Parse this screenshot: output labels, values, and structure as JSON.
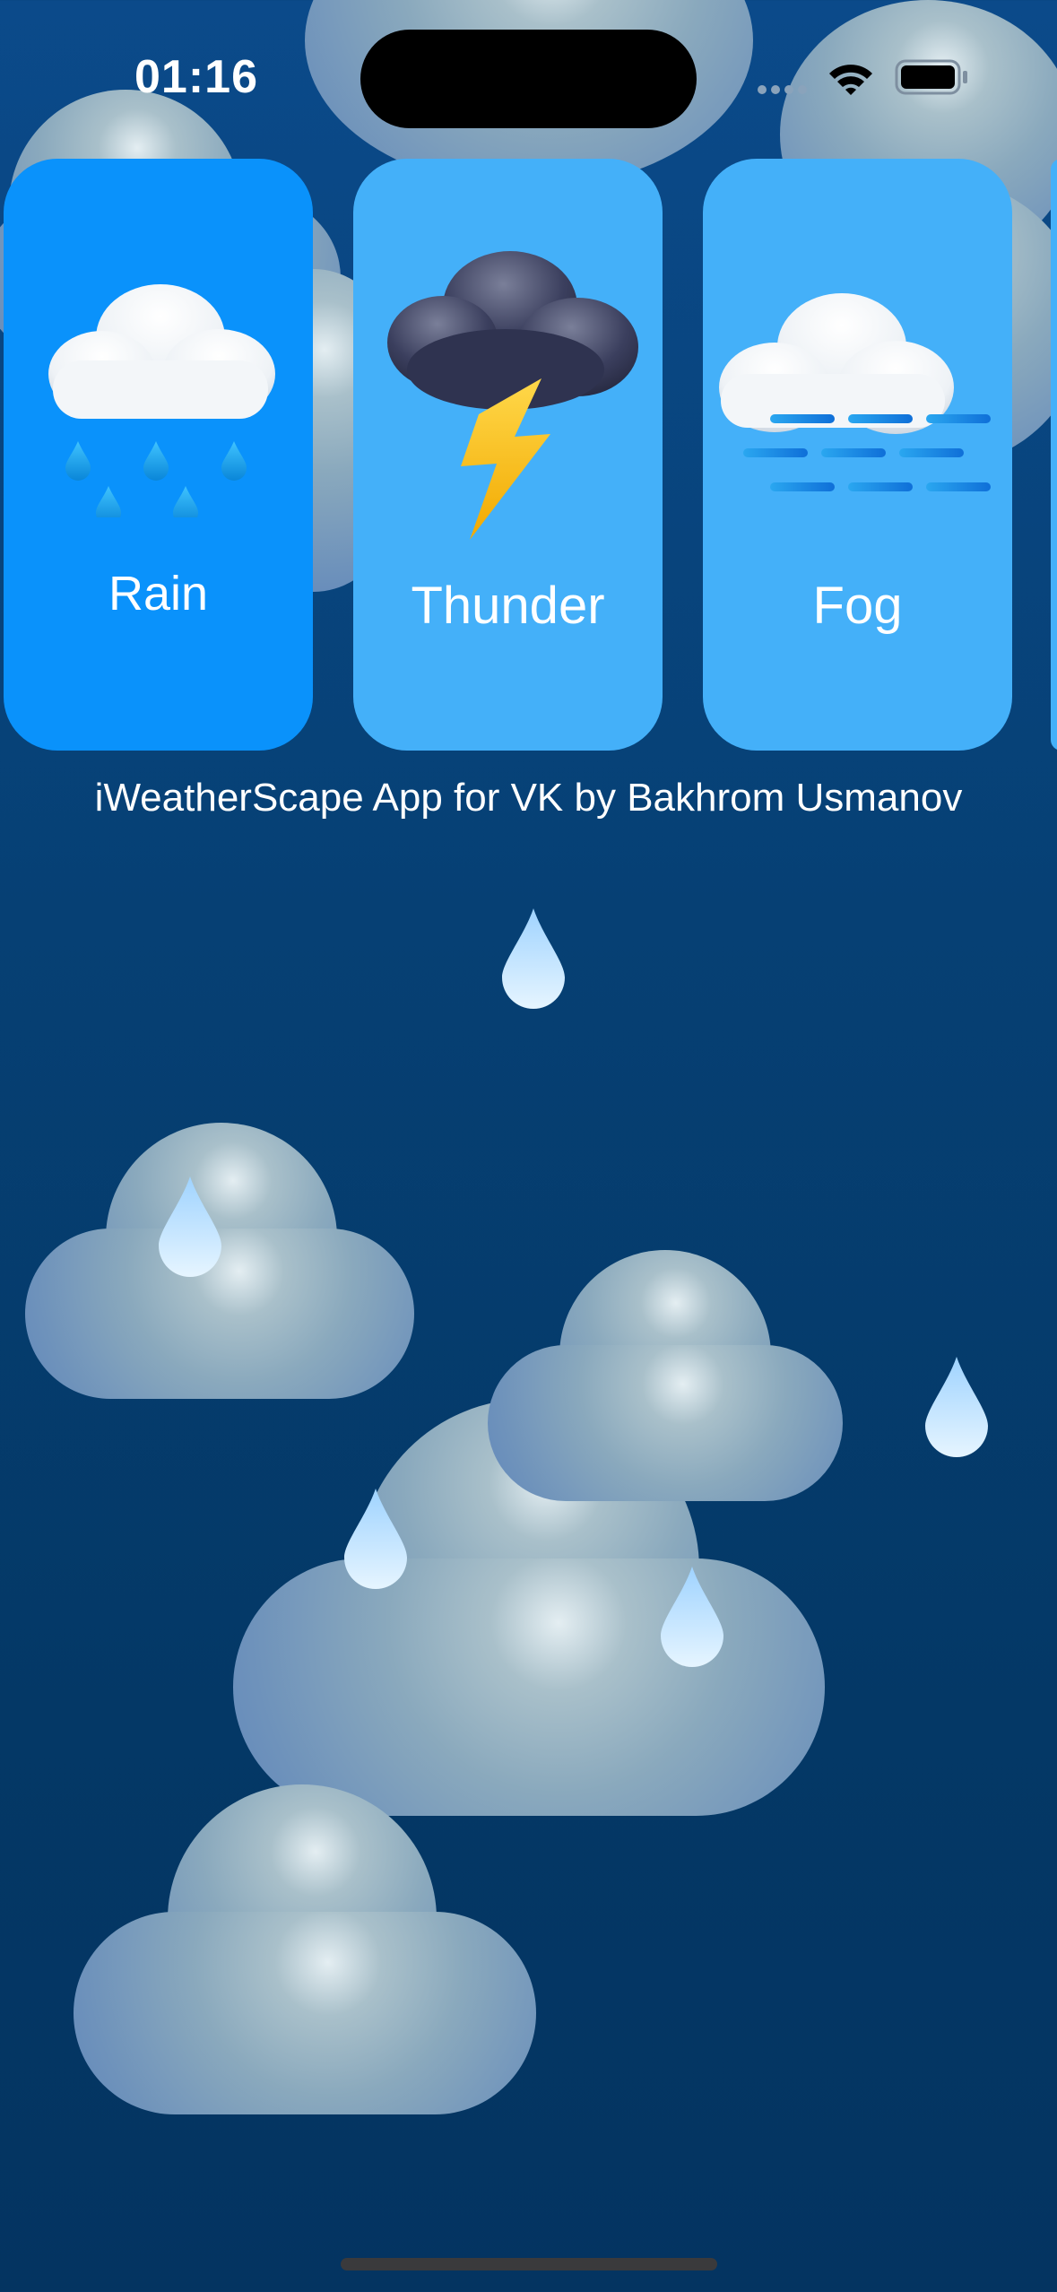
{
  "status_bar": {
    "time": "01:16",
    "icons": [
      "cellular-signal-icon",
      "wifi-icon",
      "battery-icon"
    ]
  },
  "cards": [
    {
      "label": "Rain",
      "icon": "rain-cloud-icon",
      "color": "#0a92fb"
    },
    {
      "label": "Thunder",
      "icon": "thunder-cloud-icon",
      "color": "#44b0f9"
    },
    {
      "label": "Fog",
      "icon": "fog-cloud-icon",
      "color": "#44b0f9"
    }
  ],
  "caption": "iWeatherScape App for VK by Bakhrom Usmanov",
  "colors": {
    "background": "#064074",
    "card_selected": "#0a92fb",
    "card_default": "#44b0f9",
    "cloud": "#7d9fc0"
  }
}
